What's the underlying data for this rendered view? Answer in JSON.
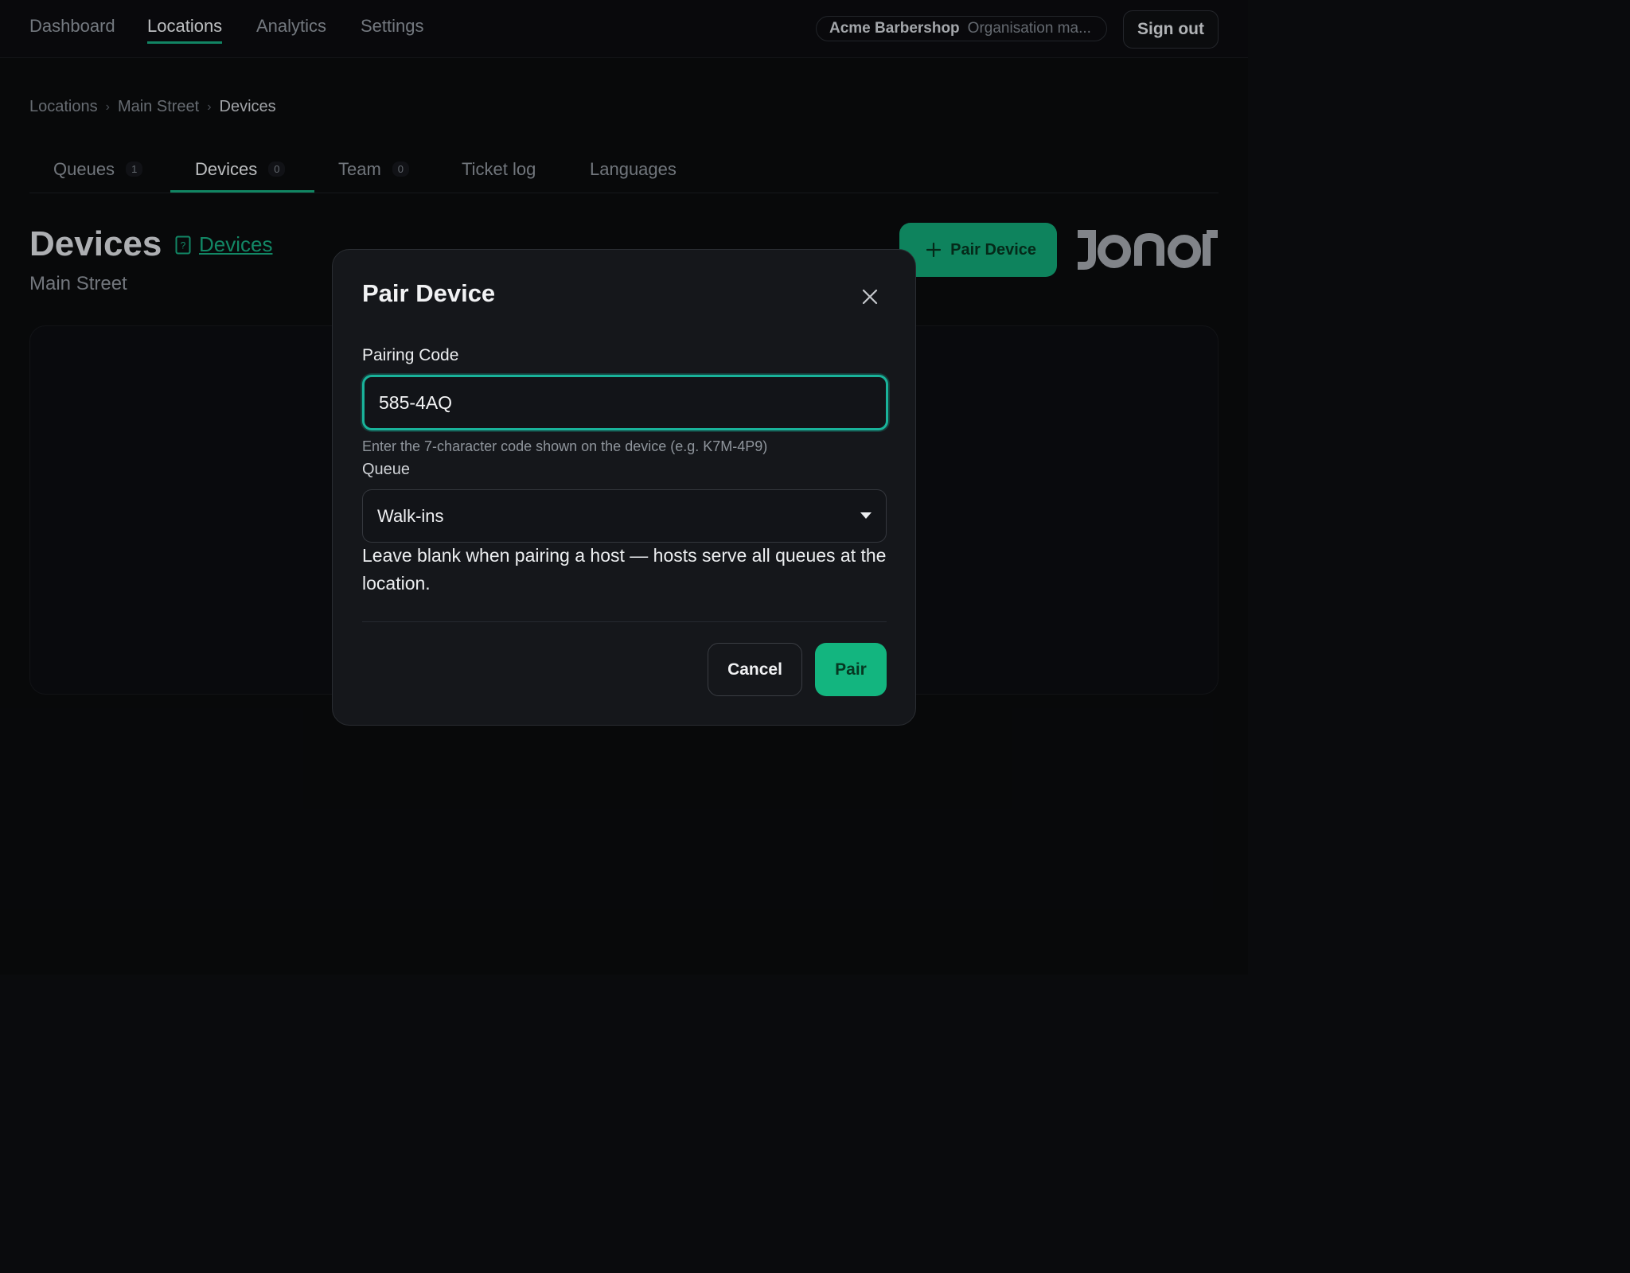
{
  "nav": {
    "items": [
      {
        "label": "Dashboard",
        "active": false
      },
      {
        "label": "Locations",
        "active": true
      },
      {
        "label": "Analytics",
        "active": false
      },
      {
        "label": "Settings",
        "active": false
      }
    ],
    "org_name": "Acme Barbershop",
    "org_role": "Organisation ma...",
    "sign_out": "Sign out"
  },
  "breadcrumb": [
    "Locations",
    "Main Street",
    "Devices"
  ],
  "tabs": [
    {
      "label": "Queues",
      "count": "1",
      "active": false
    },
    {
      "label": "Devices",
      "count": "0",
      "active": true
    },
    {
      "label": "Team",
      "count": "0",
      "active": false
    },
    {
      "label": "Ticket log",
      "count": null,
      "active": false
    },
    {
      "label": "Languages",
      "count": null,
      "active": false
    }
  ],
  "page": {
    "title": "Devices",
    "docs_link": "Devices",
    "subtitle": "Main Street",
    "pair_button": "Pair Device",
    "logo_text": "JONOT"
  },
  "modal": {
    "title": "Pair Device",
    "pairing_label": "Pairing Code",
    "pairing_value": "585-4AQ",
    "pairing_hint": "Enter the 7-character code shown on the device (e.g. K7M-4P9)",
    "queue_label": "Queue",
    "queue_selected": "Walk-ins",
    "queue_help": "Leave blank when pairing a host — hosts serve all queues at the location.",
    "cancel": "Cancel",
    "pair": "Pair"
  },
  "colors": {
    "accent": "#13b57f",
    "focus_ring": "#19b39a",
    "background": "#0a0b0d",
    "modal_bg": "#15171b"
  },
  "icons": [
    "plus-icon",
    "close-icon",
    "chevron-down-icon",
    "help-doc-icon"
  ]
}
